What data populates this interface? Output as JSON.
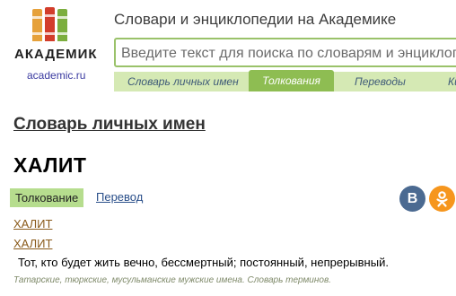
{
  "logo": {
    "word": "АКАДЕМИК",
    "url": "academic.ru",
    "book_colors": [
      "#e6a13a",
      "#d23d2b",
      "#7cae3e"
    ]
  },
  "header": {
    "title": "Словари и энциклопедии на Академике",
    "search_placeholder": "Введите текст для поиска по словарям и энциклопедиям",
    "tabs": [
      {
        "label": "Словарь личных имен",
        "active": false
      },
      {
        "label": "Толкования",
        "active": true
      },
      {
        "label": "Переводы",
        "active": false
      },
      {
        "label": "Ки",
        "active": false
      }
    ]
  },
  "content": {
    "dictionary_title": "Словарь личных имен",
    "headword": "ХАЛИТ",
    "view_tabs": {
      "interpretation": "Толкование",
      "translation": "Перевод"
    },
    "social": {
      "vk": "B",
      "ok": "ок"
    },
    "entries": [
      "ХАЛИТ",
      "ХАЛИТ"
    ],
    "definition": "Тот, кто будет жить вечно, бессмертный; постоянный, непрерывный.",
    "source": "Татарские, тюркские, мусульманские мужские имена. Словарь терминов."
  },
  "colors": {
    "accent_green": "#8ebd52",
    "tab_bar": "#d5e9b4",
    "chip": "#b6dd8e"
  }
}
